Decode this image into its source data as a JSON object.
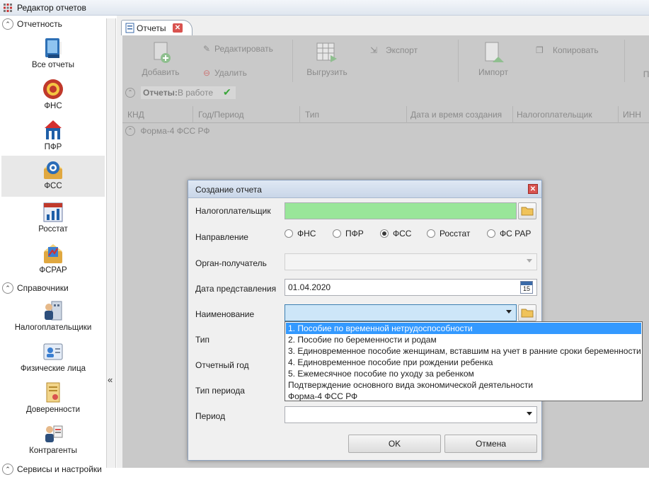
{
  "window": {
    "title": "Редактор отчетов",
    "app_icon": "app-grid-icon"
  },
  "sidebar": {
    "sections": [
      {
        "label": "Отчетность",
        "items": [
          {
            "label": "Все отчеты",
            "icon": "all-reports-icon"
          },
          {
            "label": "ФНС",
            "icon": "fns-icon"
          },
          {
            "label": "ПФР",
            "icon": "pfr-icon"
          },
          {
            "label": "ФСС",
            "icon": "fss-icon",
            "selected": true
          },
          {
            "label": "Росстат",
            "icon": "rosstat-icon"
          },
          {
            "label": "ФСРАР",
            "icon": "fsrar-icon"
          }
        ]
      },
      {
        "label": "Справочники",
        "items": [
          {
            "label": "Налогоплательщики",
            "icon": "taxpayers-icon"
          },
          {
            "label": "Физические лица",
            "icon": "persons-icon"
          },
          {
            "label": "Доверенности",
            "icon": "attorney-icon"
          },
          {
            "label": "Контрагенты",
            "icon": "counterparties-icon"
          }
        ]
      },
      {
        "label": "Сервисы и настройки"
      }
    ],
    "collapse_glyph": "«"
  },
  "tab": {
    "label": "Отчеты"
  },
  "toolbar": {
    "add": "Добавить",
    "edit": "Редактировать",
    "delete": "Удалить",
    "unload": "Выгрузить",
    "export": "Экспорт",
    "import": "Импорт",
    "copy": "Копировать",
    "cut_label": "П"
  },
  "filter": {
    "label": "Отчеты:",
    "value": "В работе"
  },
  "grid": {
    "columns": [
      "КНД",
      "Год/Период",
      "Тип",
      "Дата и время создания",
      "Налогоплательщик",
      "ИНН"
    ],
    "group": "Форма-4 ФСС РФ"
  },
  "dialog": {
    "title": "Создание отчета",
    "fields": {
      "taxpayer": "Налогоплательщик",
      "direction": "Направление",
      "recipient": "Орган-получатель",
      "date": "Дата представления",
      "name": "Наименование",
      "type": "Тип",
      "year": "Отчетный год",
      "period_type": "Тип периода",
      "period": "Период"
    },
    "taxpayer_value": "",
    "date_value": "01.04.2020",
    "calendar_day": "15",
    "directions": [
      {
        "label": "ФНС",
        "checked": false
      },
      {
        "label": "ПФР",
        "checked": false
      },
      {
        "label": "ФСС",
        "checked": true
      },
      {
        "label": "Росстат",
        "checked": false
      },
      {
        "label": "ФС РАР",
        "checked": false
      }
    ],
    "ok": "OK",
    "cancel": "Отмена",
    "taxpayer_fill_color": "#99e699",
    "name_fill_color": "#cde6f8"
  },
  "dropdown": {
    "items": [
      "1. Пособие по временной нетрудоспособности",
      "2. Пособие по беременности и родам",
      "3. Единовременное пособие женщинам, вставшим на учет в ранние сроки беременности",
      "4. Единовременное пособие при рождении ребенка",
      "5. Ежемесячное пособие по уходу за ребенком",
      "Подтверждение основного вида экономической деятельности",
      "Форма-4 ФСС РФ"
    ],
    "highlighted_index": 0,
    "highlight_color": "#3399ff"
  }
}
